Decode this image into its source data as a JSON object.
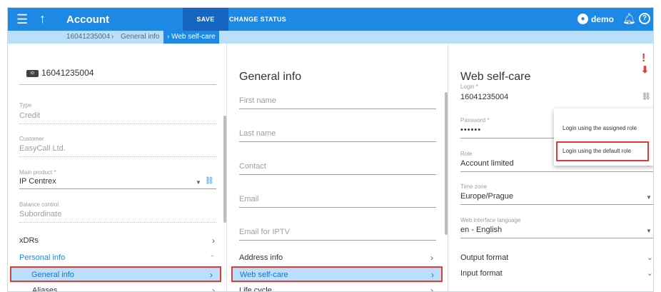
{
  "topbar": {
    "title": "Account",
    "save_label": "SAVE",
    "change_status_label": "CHANGE STATUS",
    "user_name": "demo",
    "color": "#1e88e5"
  },
  "breadcrumb": {
    "items": [
      "16041235004",
      "General info",
      "Web self-care"
    ]
  },
  "left_panel": {
    "account_id": "16041235004",
    "id_badge": "ID",
    "type_label": "Type",
    "type_value": "Credit",
    "customer_label": "Customer",
    "customer_value": "EasyCall Ltd.",
    "main_product_label": "Main product *",
    "main_product_value": "IP Centrex",
    "balance_control_label": "Balance control",
    "balance_control_value": "Subordinate",
    "nav": {
      "xdrs": "xDRs",
      "personal_info": "Personal info",
      "general_info": "General info",
      "aliases": "Aliases"
    }
  },
  "middle_panel": {
    "title": "General info",
    "first_name_placeholder": "First name",
    "last_name_placeholder": "Last name",
    "contact_placeholder": "Contact",
    "email_placeholder": "Email",
    "email_iptv_placeholder": "Email for IPTV",
    "nav": {
      "address_info": "Address info",
      "web_self_care": "Web self-care",
      "life_cycle": "Life cycle"
    }
  },
  "right_panel": {
    "title": "Web self-care",
    "login_label": "Login *",
    "login_value": "16041235004",
    "password_label": "Password *",
    "password_value": "••••••",
    "role_label": "Role",
    "role_value": "Account limited",
    "time_zone_label": "Time zone",
    "time_zone_value": "Europe/Prague",
    "web_lang_label": "Web interface language",
    "web_lang_value": "en - English",
    "output_format": "Output format",
    "input_format": "Input format"
  },
  "login_popup": {
    "option_assigned": "Login using the assigned role",
    "option_default": "Login using the default role"
  },
  "icons": [
    "menu-icon",
    "arrow-up-icon",
    "user-icon",
    "bell-icon",
    "help-icon",
    "link-icon",
    "chevron-right-icon",
    "chevron-down-icon",
    "dropdown-arrow-icon"
  ],
  "colors": {
    "accent": "#1e88e5",
    "highlight": "#e53935",
    "selected_bg": "#bbdefb"
  }
}
